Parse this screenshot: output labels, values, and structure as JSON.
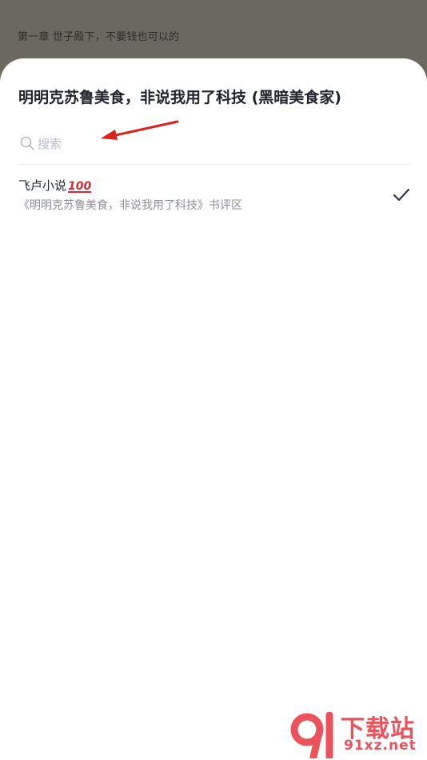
{
  "background": {
    "chapter_text": "第一章 世子殿下，不要钱也可以的"
  },
  "sheet": {
    "title": "明明克苏鲁美食，非说我用了科技 (黑暗美食家)",
    "search": {
      "placeholder": "搜索",
      "value": ""
    },
    "items": [
      {
        "name": "飞卢小说",
        "badge": "100",
        "subtitle": "《明明克苏鲁美食，非说我用了科技》书评区",
        "selected": true
      }
    ]
  },
  "watermark": {
    "text": "下载站",
    "url": "91xz.net",
    "logo": "9l"
  },
  "colors": {
    "overlay": "#6b6860",
    "accent_red": "#e0262e",
    "check": "#2b3441"
  }
}
